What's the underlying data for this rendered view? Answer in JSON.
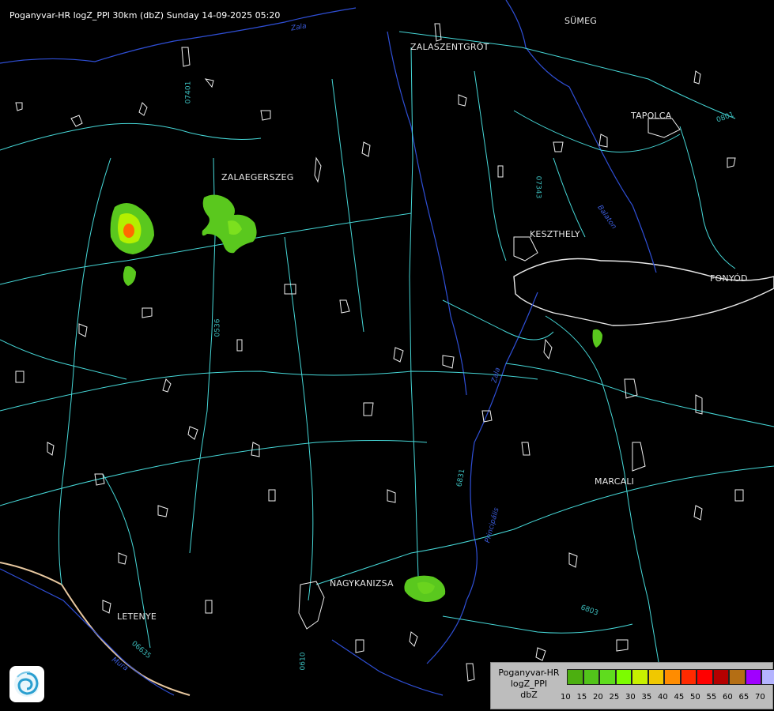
{
  "title": "Poganyvar-HR logZ_PPI 30km (dbZ) Sunday 14-09-2025 05:20",
  "cities": [
    {
      "name": "ZALASZENTGRÓT"
    },
    {
      "name": "SÜMEG"
    },
    {
      "name": "TAPOLCA"
    },
    {
      "name": "ZALAEGERSZEG"
    },
    {
      "name": "KESZTHELY"
    },
    {
      "name": "FONYÓD"
    },
    {
      "name": "MARCALI"
    },
    {
      "name": "NAGYKANIZSA"
    },
    {
      "name": "LETENYE"
    }
  ],
  "roads": [
    "07401",
    "07343",
    "0801",
    "0536",
    "6831",
    "6803",
    "06635",
    "0610"
  ],
  "rivers": [
    "Zala",
    "Balaton",
    "Principális",
    "Mura",
    "Zala"
  ],
  "legend": {
    "line1": "Poganyvar-HR",
    "line2": "logZ_PPI",
    "line3": "dbZ",
    "levels": [
      "10",
      "15",
      "20",
      "25",
      "30",
      "35",
      "40",
      "45",
      "50",
      "55",
      "60",
      "65",
      "70"
    ],
    "colors": [
      "#4caf10",
      "#52c41a",
      "#5fdc1e",
      "#7cfc00",
      "#c8f000",
      "#f0c800",
      "#ff8c00",
      "#ff2a00",
      "#ff0000",
      "#b40000",
      "#b46e14",
      "#a000ff",
      "#b4b4ff"
    ]
  },
  "echo_colors": {
    "weak": "#5ac81e",
    "mid": "#b4f000",
    "strong": "#ff6a00"
  }
}
